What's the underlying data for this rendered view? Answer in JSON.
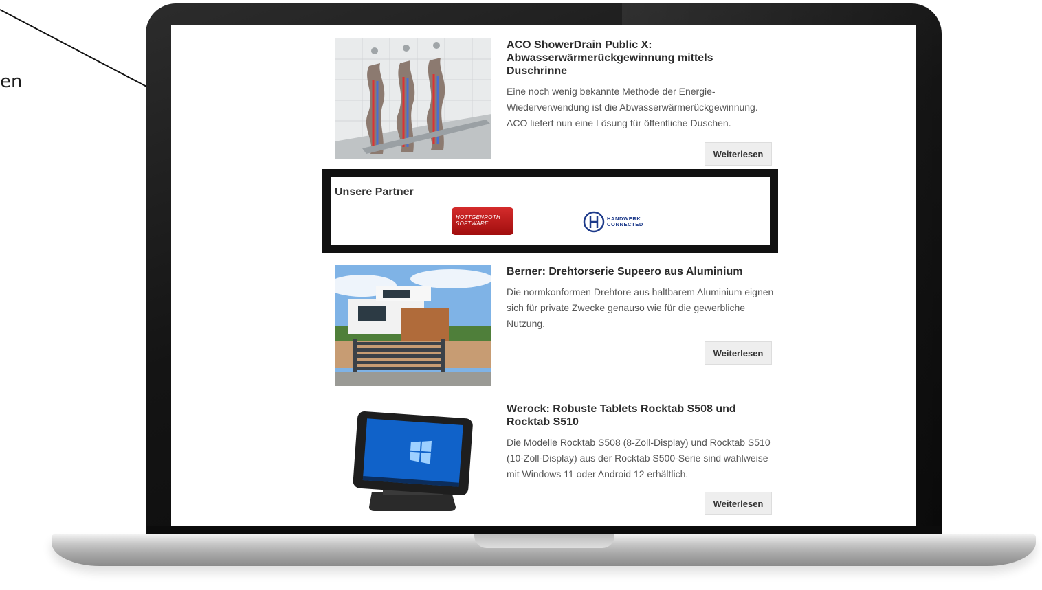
{
  "side_text": "en",
  "articles": [
    {
      "title": "ACO ShowerDrain Public X: Abwasserwärmerückgewinnung mittels Duschrinne",
      "description": "Eine noch wenig bekannte Methode der Energie-Wiederverwendung ist die Abwasserwärmerückgewinnung. ACO liefert nun eine Lösung für öffentliche Duschen.",
      "button": "Weiterlesen"
    },
    {
      "title": "Berner: Drehtorserie Supeero aus Aluminium",
      "description": "Die normkonformen Drehtore aus haltbarem Aluminium eignen sich für private Zwecke genauso wie für die gewerbliche Nutzung.",
      "button": "Weiterlesen"
    },
    {
      "title": "Werock: Robuste Tablets Rocktab S508 und Rocktab S510",
      "description": "Die Modelle Rocktab S508 (8-Zoll-Display) und Rocktab S510 (10-Zoll-Display) aus der Rocktab S500-Serie sind wahlweise mit Windows 11 oder Android 12 erhältlich.",
      "button": "Weiterlesen"
    }
  ],
  "partners": {
    "heading": "Unsere Partner",
    "logos": [
      {
        "name": "Hottgenroth Software",
        "line1": "Hottgenroth",
        "line2": "Software",
        "color": "#c41e1e"
      },
      {
        "name": "Handwerk Connected",
        "line1": "HANDWERK",
        "line2": "CONNECTED",
        "color": "#1d3a8a"
      }
    ]
  }
}
